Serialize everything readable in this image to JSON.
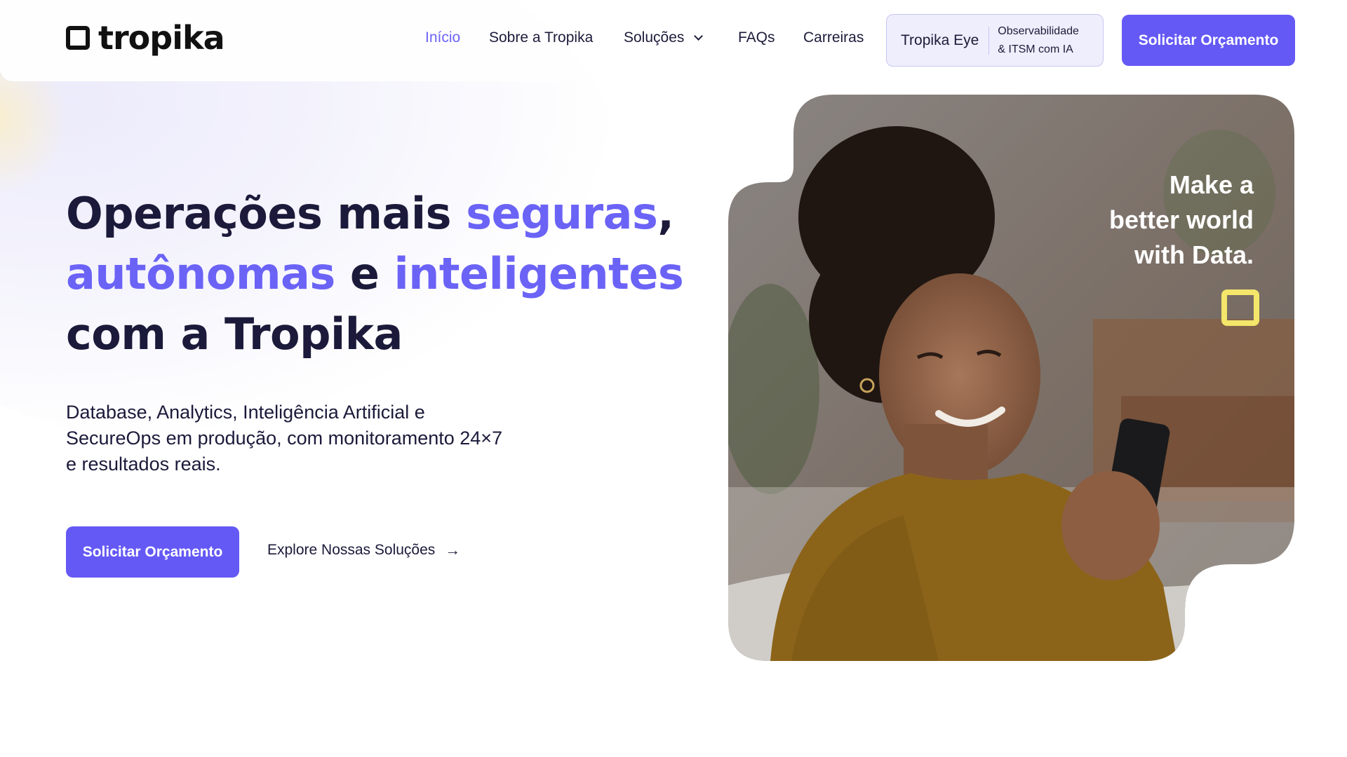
{
  "brand": {
    "name": "tropika",
    "logo_icon": "square-outline-icon"
  },
  "nav": {
    "items": [
      {
        "label": "Início",
        "active": true
      },
      {
        "label": "Sobre a Tropika"
      },
      {
        "label": "Soluções",
        "has_dropdown": true
      },
      {
        "label": "FAQs"
      },
      {
        "label": "Carreiras"
      }
    ],
    "eye": {
      "name": "Tropika Eye",
      "desc_line1": "Observabilidade",
      "desc_line2": "& ITSM com IA"
    },
    "cta": "Solicitar Orçamento"
  },
  "hero": {
    "headline": {
      "part1": "Operações mais ",
      "hl1": "seguras",
      "part2": ",",
      "hl2": "autônomas",
      "part3": " e ",
      "hl3": "inteligentes",
      "line3": "com a Tropika"
    },
    "subtitle": "Database, Analytics, Inteligência Artificial e SecureOps em produção, com monitoramento 24×7 e resultados reais.",
    "primary_cta": "Solicitar Orçamento",
    "secondary_cta": "Explore Nossas Soluções",
    "secondary_icon": "arrow-right-icon"
  },
  "image_card": {
    "tagline_line1": "Make a",
    "tagline_line2": "better world",
    "tagline_line3": "with Data."
  },
  "colors": {
    "accent": "#6459f5",
    "highlight_text": "#6b63f6",
    "tag_yellow": "#f3e66a",
    "text": "#1b1a3a"
  }
}
